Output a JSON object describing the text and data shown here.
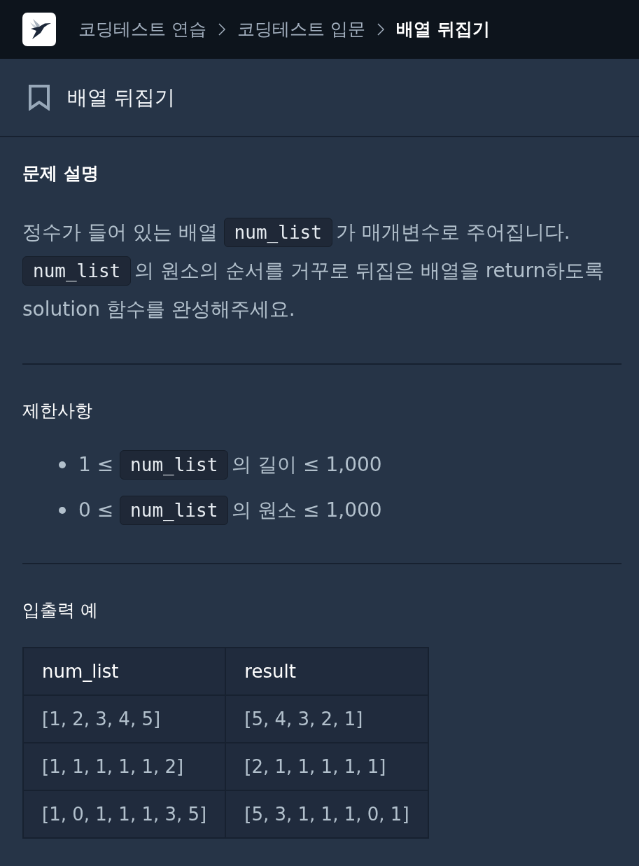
{
  "breadcrumb": [
    {
      "label": "코딩테스트 연습",
      "current": false
    },
    {
      "label": "코딩테스트 입문",
      "current": false
    },
    {
      "label": "배열 뒤집기",
      "current": true
    }
  ],
  "title": {
    "text": "배열 뒤집기",
    "bookmarked": false
  },
  "sections": [
    {
      "kind": "paragraph",
      "heading": "문제 설명",
      "segments": [
        {
          "kind": "text",
          "text": "정수가 들어 있는 배열 "
        },
        {
          "kind": "code",
          "text": "num_list"
        },
        {
          "kind": "text",
          "text": "가 매개변수로 주어집니다. "
        },
        {
          "kind": "code",
          "text": "num_list"
        },
        {
          "kind": "text",
          "text": "의 원소의 순서를 거꾸로 뒤집은 배열을 return하도록 solution 함수를 완성해주세요."
        }
      ]
    },
    {
      "kind": "list",
      "heading": "제한사항",
      "items": [
        {
          "segments": [
            {
              "kind": "text",
              "text": "1 ≤ "
            },
            {
              "kind": "code",
              "text": "num_list"
            },
            {
              "kind": "text",
              "text": "의 길이 ≤ 1,000"
            }
          ]
        },
        {
          "segments": [
            {
              "kind": "text",
              "text": "0 ≤ "
            },
            {
              "kind": "code",
              "text": "num_list"
            },
            {
              "kind": "text",
              "text": "의 원소 ≤ 1,000"
            }
          ]
        }
      ]
    },
    {
      "kind": "table",
      "heading": "입출력 예",
      "columns": [
        "num_list",
        "result"
      ],
      "rows": [
        [
          "[1, 2, 3, 4, 5]",
          "[5, 4, 3, 2, 1]"
        ],
        [
          "[1, 1, 1, 1, 1, 2]",
          "[2, 1, 1, 1, 1, 1]"
        ],
        [
          "[1, 0, 1, 1, 1, 3, 5]",
          "[5, 3, 1, 1, 1, 0, 1]"
        ]
      ]
    }
  ]
}
